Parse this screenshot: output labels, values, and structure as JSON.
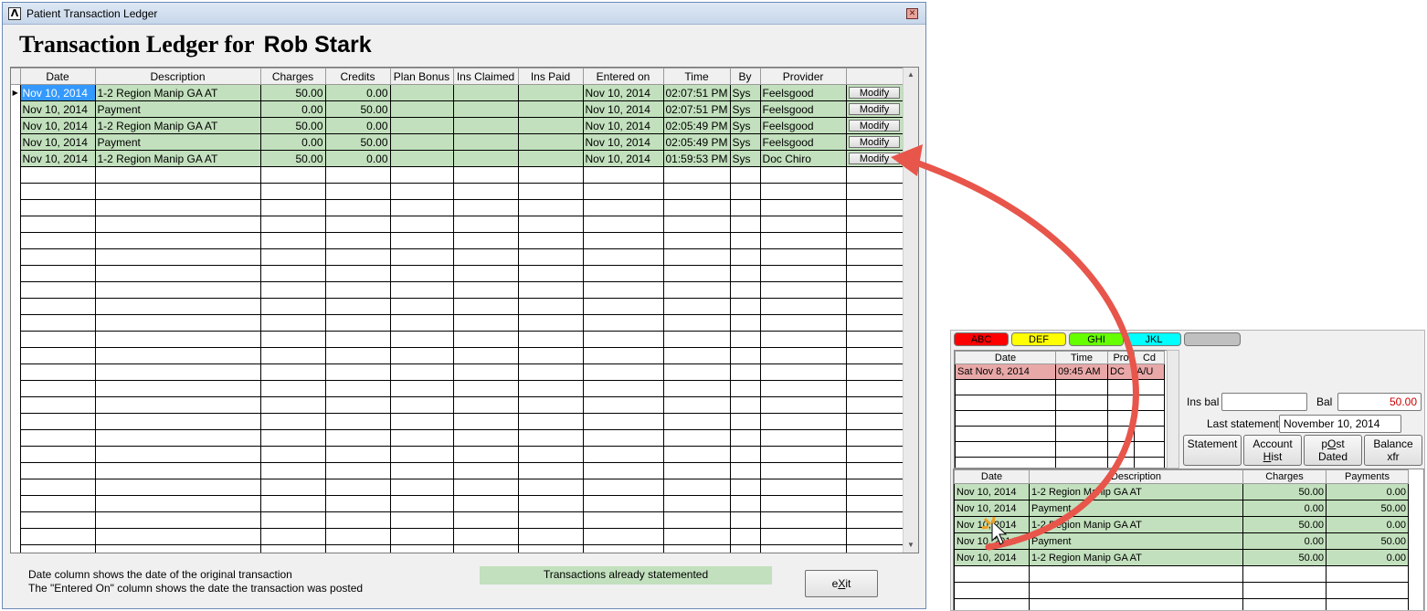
{
  "window": {
    "title": "Patient Transaction Ledger",
    "heading_prefix": "Transaction Ledger for",
    "patient_name": "Rob Stark"
  },
  "ledger": {
    "columns": [
      "Date",
      "Description",
      "Charges",
      "Credits",
      "Plan Bonus",
      "Ins Claimed",
      "Ins Paid",
      "Entered on",
      "Time",
      "By",
      "Provider",
      ""
    ],
    "modify_label": "Modify",
    "rows": [
      {
        "date": "Nov 10, 2014",
        "description": "1-2  Region Manip  GA  AT",
        "charges": "50.00",
        "credits": "0.00",
        "plan_bonus": "",
        "ins_claimed": "",
        "ins_paid": "",
        "entered_on": "Nov 10, 2014",
        "time": "02:07:51 PM",
        "by": "Sys",
        "provider": "Feelsgood"
      },
      {
        "date": "Nov 10, 2014",
        "description": "Payment",
        "charges": "0.00",
        "credits": "50.00",
        "plan_bonus": "",
        "ins_claimed": "",
        "ins_paid": "",
        "entered_on": "Nov 10, 2014",
        "time": "02:07:51 PM",
        "by": "Sys",
        "provider": "Feelsgood"
      },
      {
        "date": "Nov 10, 2014",
        "description": "1-2  Region Manip  GA  AT",
        "charges": "50.00",
        "credits": "0.00",
        "plan_bonus": "",
        "ins_claimed": "",
        "ins_paid": "",
        "entered_on": "Nov 10, 2014",
        "time": "02:05:49 PM",
        "by": "Sys",
        "provider": "Feelsgood"
      },
      {
        "date": "Nov 10, 2014",
        "description": "Payment",
        "charges": "0.00",
        "credits": "50.00",
        "plan_bonus": "",
        "ins_claimed": "",
        "ins_paid": "",
        "entered_on": "Nov 10, 2014",
        "time": "02:05:49 PM",
        "by": "Sys",
        "provider": "Feelsgood"
      },
      {
        "date": "Nov 10, 2014",
        "description": "1-2  Region Manip  GA  AT",
        "charges": "50.00",
        "credits": "0.00",
        "plan_bonus": "",
        "ins_claimed": "",
        "ins_paid": "",
        "entered_on": "Nov 10, 2014",
        "time": "01:59:53 PM",
        "by": "Sys",
        "provider": "Doc Chiro"
      }
    ]
  },
  "footer": {
    "note1": "Date column shows the date of the original transaction",
    "note2": "The \"Entered On\" column shows the date the transaction was posted",
    "legend": "Transactions already statemented",
    "exit_pre": "e",
    "exit_key": "X",
    "exit_post": "it"
  },
  "inset": {
    "tabs": [
      {
        "label": "ABC",
        "color": "#ff0000"
      },
      {
        "label": "DEF",
        "color": "#ffff00"
      },
      {
        "label": "GHI",
        "color": "#66ff00"
      },
      {
        "label": "JKL",
        "color": "#00ffff"
      },
      {
        "label": "",
        "color": "#c0c0c0"
      }
    ],
    "appointments": {
      "columns": [
        "Date",
        "Time",
        "Pro",
        "Cd"
      ],
      "rows": [
        {
          "date": "Sat Nov 8, 2014",
          "time": "09:45 AM",
          "pro": "DC",
          "cd": "A/U"
        }
      ]
    },
    "ins_bal_label": "Ins bal",
    "ins_bal_value": "",
    "bal_label": "Bal",
    "bal_value": "50.00",
    "last_statement_label": "Last statement",
    "last_statement_value": "November 10, 2014",
    "buttons": {
      "statement": "Statement",
      "account_l1": "Account",
      "account_l2_key": "H",
      "account_l2_post": "ist",
      "post_l1_pre": "p",
      "post_l1_key": "O",
      "post_l1_post": "st",
      "post_l2": "Dated",
      "balance_l1": "Balance",
      "balance_l2": "xfr"
    },
    "transactions": {
      "columns": [
        "Date",
        "Description",
        "Charges",
        "Payments"
      ],
      "rows": [
        {
          "date": "Nov 10, 2014",
          "description": "1-2  Region Manip  GA  AT",
          "charges": "50.00",
          "payments": "0.00"
        },
        {
          "date": "Nov 10, 2014",
          "description": "Payment",
          "charges": "0.00",
          "payments": "50.00"
        },
        {
          "date": "Nov 10, 2014",
          "description": "1-2  Region Manip  GA  AT",
          "charges": "50.00",
          "payments": "0.00"
        },
        {
          "date": "Nov 10, 2014",
          "description": "Payment",
          "charges": "0.00",
          "payments": "50.00"
        },
        {
          "date": "Nov 10, 2014",
          "description": "1-2  Region Manip  GA  AT",
          "charges": "50.00",
          "payments": "0.00"
        }
      ]
    }
  },
  "colors": {
    "statemented_row": "#c2e0bd",
    "appointment_row": "#e9a8a8",
    "selection": "#3399ff",
    "annotation_arrow": "#e8554a",
    "balance_text": "#cc0000"
  }
}
